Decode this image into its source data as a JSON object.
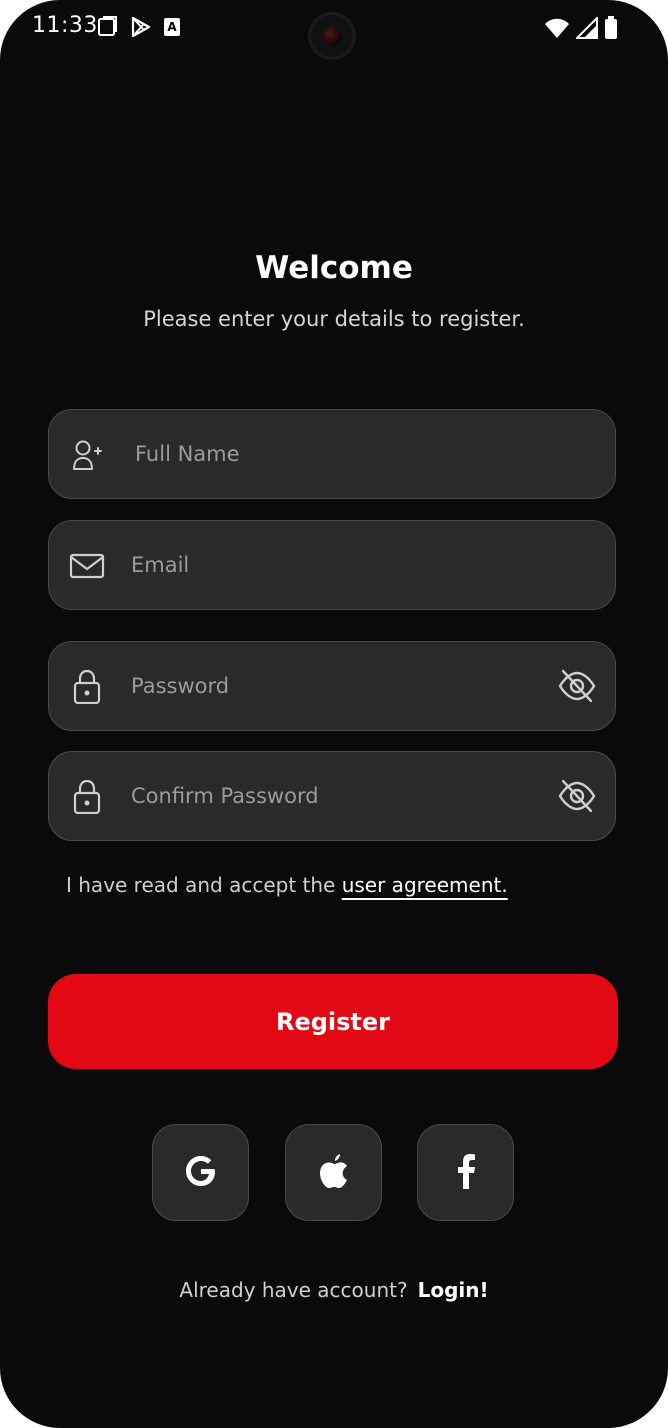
{
  "status_bar": {
    "time": "11:33",
    "icons_left": [
      "screenshot-icon",
      "play-store-icon",
      "translate-icon"
    ],
    "icons_right": [
      "wifi-icon",
      "cellular-signal-icon",
      "battery-icon"
    ]
  },
  "header": {
    "title": "Welcome",
    "subtitle": "Please enter your details to register."
  },
  "form": {
    "full_name": {
      "placeholder": "Full Name",
      "value": "",
      "icon": "add-user-icon"
    },
    "email": {
      "placeholder": "Email",
      "value": "",
      "icon": "mail-icon"
    },
    "password": {
      "placeholder": "Password",
      "value": "",
      "icon": "lock-icon",
      "toggle_icon": "eye-off-icon"
    },
    "confirm_password": {
      "placeholder": "Confirm Password",
      "value": "",
      "icon": "lock-icon",
      "toggle_icon": "eye-off-icon"
    }
  },
  "agreement": {
    "text": "I have read and accept the ",
    "link": "user agreement."
  },
  "register_label": "Register",
  "social": [
    {
      "name": "google",
      "icon": "google-icon"
    },
    {
      "name": "apple",
      "icon": "apple-icon"
    },
    {
      "name": "facebook",
      "icon": "facebook-icon"
    }
  ],
  "footer": {
    "text": "Already have account?",
    "login_label": "Login!"
  },
  "colors": {
    "background": "#0a0a0a",
    "field_bg": "#2a2a2a",
    "field_border": "#4a4a4a",
    "accent": "#e30914",
    "text_primary": "#ffffff",
    "text_secondary": "#cfcfcf",
    "placeholder": "#9b9b9b"
  }
}
